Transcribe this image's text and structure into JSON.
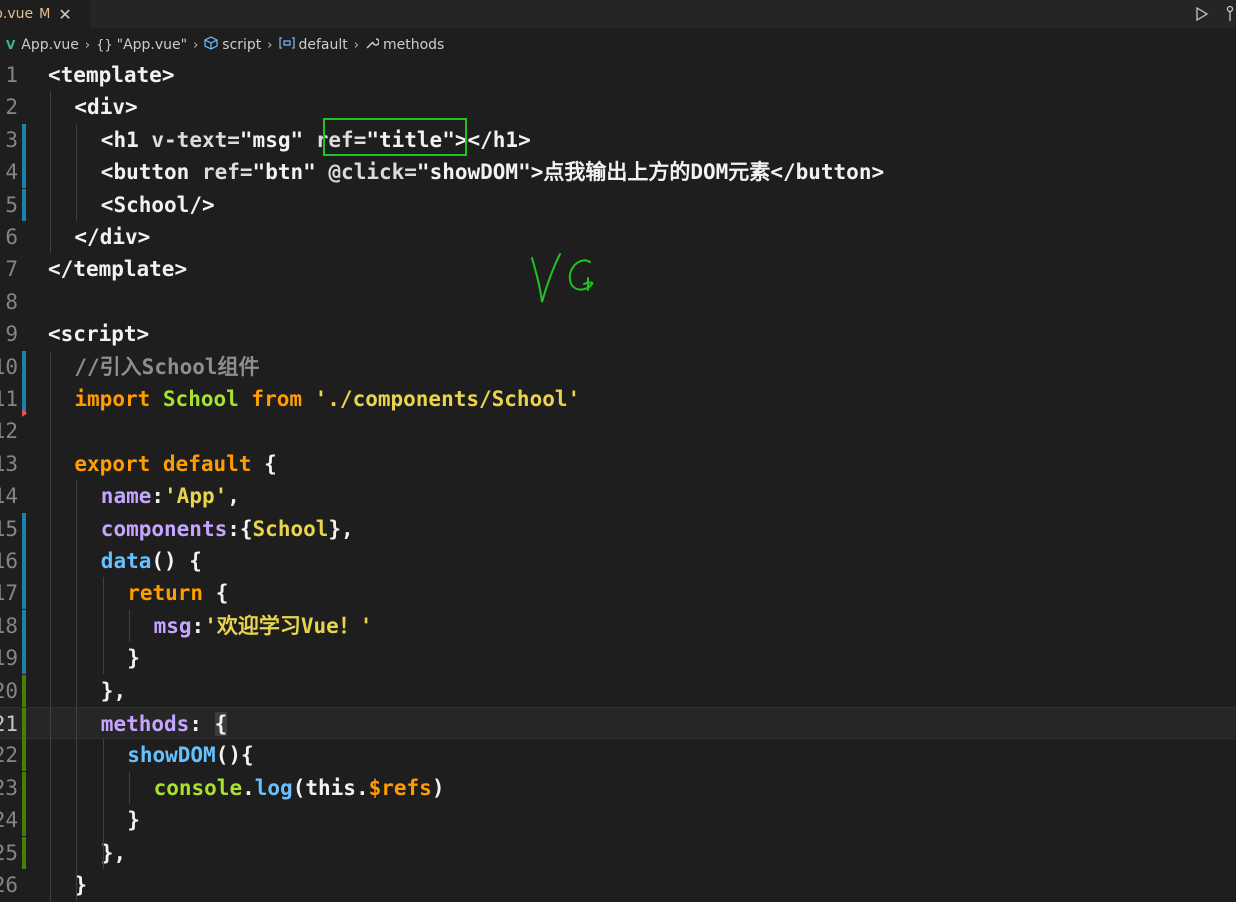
{
  "tab": {
    "name": "p.vue",
    "modified": "M",
    "close": "✕"
  },
  "breadcrumb": [
    {
      "label": "App.vue",
      "icon": "vue-icon"
    },
    {
      "label": "\"App.vue\"",
      "icon": "braces-icon"
    },
    {
      "label": "script",
      "icon": "cube-icon"
    },
    {
      "label": "default",
      "icon": "variable-icon"
    },
    {
      "label": "methods",
      "icon": "wrench-icon"
    }
  ],
  "lines": [
    {
      "n": "1",
      "tokens": [
        [
          "t-tag",
          "<"
        ],
        [
          "t-tagname",
          "template"
        ],
        [
          "t-tag",
          ">"
        ]
      ],
      "indent": 0
    },
    {
      "n": "2",
      "tokens": [
        [
          "t-tag",
          "<"
        ],
        [
          "t-tagname",
          "div"
        ],
        [
          "t-tag",
          ">"
        ]
      ],
      "indent": 1
    },
    {
      "n": "3",
      "tokens": [
        [
          "t-tag",
          "<"
        ],
        [
          "t-tagname",
          "h1 "
        ],
        [
          "t-attr",
          "v-text="
        ],
        [
          "t-plain",
          "\"msg\" "
        ],
        [
          "t-attr",
          "ref="
        ],
        [
          "t-plain",
          "\"title\""
        ],
        [
          "t-tag",
          "></h1>"
        ]
      ],
      "indent": 2
    },
    {
      "n": "4",
      "tokens": [
        [
          "t-tag",
          "<"
        ],
        [
          "t-tagname",
          "button "
        ],
        [
          "t-attr",
          "ref="
        ],
        [
          "t-plain",
          "\"btn\" "
        ],
        [
          "t-attr",
          "@click="
        ],
        [
          "t-plain",
          "\"showDOM\""
        ],
        [
          "t-tag",
          ">"
        ],
        [
          "t-plain",
          "点我输出上方的DOM元素"
        ],
        [
          "t-tag",
          "</button>"
        ]
      ],
      "indent": 2
    },
    {
      "n": "5",
      "tokens": [
        [
          "t-tag",
          "<"
        ],
        [
          "t-tagname",
          "School"
        ],
        [
          "t-tag",
          "/>"
        ]
      ],
      "indent": 2
    },
    {
      "n": "6",
      "tokens": [
        [
          "t-tag",
          "</"
        ],
        [
          "t-tagname",
          "div"
        ],
        [
          "t-tag",
          ">"
        ]
      ],
      "indent": 1
    },
    {
      "n": "7",
      "tokens": [
        [
          "t-tag",
          "</"
        ],
        [
          "t-tagname",
          "template"
        ],
        [
          "t-tag",
          ">"
        ]
      ],
      "indent": 0
    },
    {
      "n": "8",
      "tokens": [],
      "indent": 0
    },
    {
      "n": "9",
      "tokens": [
        [
          "t-tag",
          "<"
        ],
        [
          "t-tagname",
          "script"
        ],
        [
          "t-tag",
          ">"
        ]
      ],
      "indent": 0
    },
    {
      "n": "10",
      "tokens": [
        [
          "t-cmt",
          "//引入School组件"
        ]
      ],
      "indent": 1
    },
    {
      "n": "11",
      "tokens": [
        [
          "t-kw",
          "import "
        ],
        [
          "t-id",
          "School "
        ],
        [
          "t-kw",
          "from "
        ],
        [
          "t-yellow",
          "'./components/School'"
        ]
      ],
      "indent": 1
    },
    {
      "n": "12",
      "tokens": [],
      "indent": 0
    },
    {
      "n": "13",
      "tokens": [
        [
          "t-kw",
          "export "
        ],
        [
          "t-kw",
          "default "
        ],
        [
          "t-plain",
          "{"
        ]
      ],
      "indent": 1
    },
    {
      "n": "14",
      "tokens": [
        [
          "t-prop",
          "name"
        ],
        [
          "t-plain",
          ":"
        ],
        [
          "t-yellow",
          "'App'"
        ],
        [
          "t-plain",
          ","
        ]
      ],
      "indent": 2
    },
    {
      "n": "15",
      "tokens": [
        [
          "t-prop",
          "components"
        ],
        [
          "t-plain",
          ":{"
        ],
        [
          "t-yellow",
          "School"
        ],
        [
          "t-plain",
          "},"
        ]
      ],
      "indent": 2
    },
    {
      "n": "16",
      "tokens": [
        [
          "t-fn",
          "data"
        ],
        [
          "t-plain",
          "() {"
        ]
      ],
      "indent": 2
    },
    {
      "n": "17",
      "tokens": [
        [
          "t-kw",
          "return "
        ],
        [
          "t-plain",
          "{"
        ]
      ],
      "indent": 3
    },
    {
      "n": "18",
      "tokens": [
        [
          "t-prop",
          "msg"
        ],
        [
          "t-plain",
          ":"
        ],
        [
          "t-yellow",
          "'欢迎学习Vue！'"
        ]
      ],
      "indent": 4
    },
    {
      "n": "19",
      "tokens": [
        [
          "t-plain",
          "}"
        ]
      ],
      "indent": 3
    },
    {
      "n": "20",
      "tokens": [
        [
          "t-plain",
          "},"
        ]
      ],
      "indent": 2
    },
    {
      "n": "21",
      "tokens": [
        [
          "t-prop",
          "methods"
        ],
        [
          "t-plain",
          ": "
        ],
        [
          "t-plain",
          "{"
        ]
      ],
      "indent": 2,
      "current": true
    },
    {
      "n": "22",
      "tokens": [
        [
          "t-fn",
          "showDOM"
        ],
        [
          "t-plain",
          "(){"
        ]
      ],
      "indent": 3
    },
    {
      "n": "23",
      "tokens": [
        [
          "t-id",
          "console"
        ],
        [
          "t-plain",
          "."
        ],
        [
          "t-fn",
          "log"
        ],
        [
          "t-plain",
          "("
        ],
        [
          "t-plain",
          "this"
        ],
        [
          "t-plain",
          "."
        ],
        [
          "t-orange",
          "$refs"
        ],
        [
          "t-plain",
          ")"
        ]
      ],
      "indent": 4
    },
    {
      "n": "24",
      "tokens": [
        [
          "t-plain",
          "}"
        ]
      ],
      "indent": 3
    },
    {
      "n": "25",
      "tokens": [
        [
          "t-plain",
          "},"
        ]
      ],
      "indent": 2
    },
    {
      "n": "26",
      "tokens": [
        [
          "t-plain",
          "}"
        ]
      ],
      "indent": 1
    }
  ],
  "annotation": {
    "handwriting": "VG"
  },
  "colors": {
    "highlight_box": "#21c321",
    "modified_blue": "#1b81a8",
    "added_green": "#487e02"
  }
}
